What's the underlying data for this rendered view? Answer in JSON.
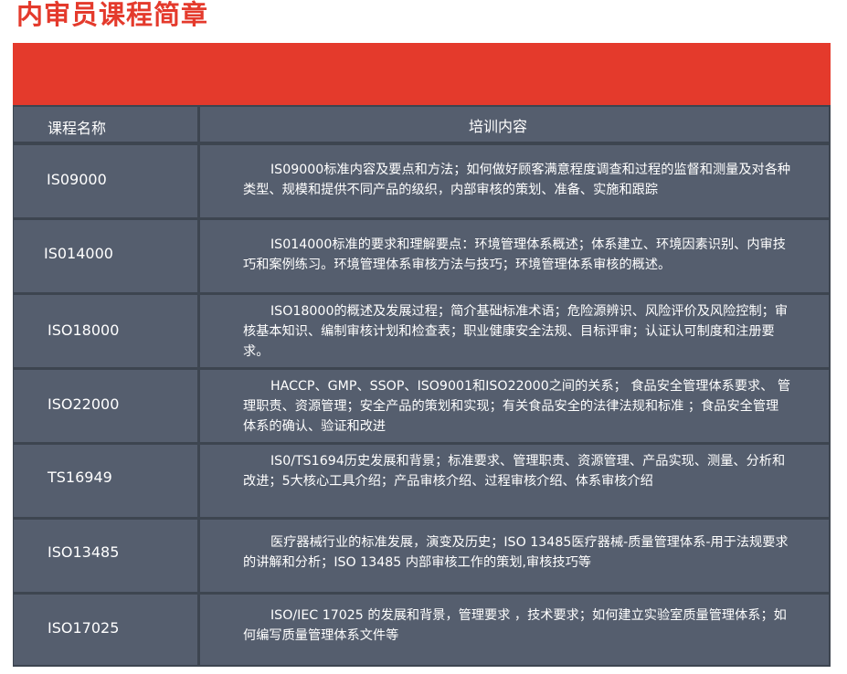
{
  "title": "内审员课程简章",
  "table": {
    "header": {
      "name_label": "课程名称",
      "content_label": "培训内容"
    },
    "rows": [
      {
        "name": "IS09000",
        "content": "IS09000标准内容及要点和方法；如何做好顾客满意程度调查和过程的监督和测量及对各种类型、规模和提供不同产品的级织，内部审核的策划、准备、实施和跟踪"
      },
      {
        "name": "IS014000",
        "content": "IS014000标准的要求和理解要点：环境管理体系概述；体系建立、环境因素识别、内审技巧和案例练习。环境管理体系审核方法与技巧；环境管理体系审核的概述。"
      },
      {
        "name": "ISO18000",
        "content": "ISO18000的概述及发展过程；简介基础标准术语；危险源辨识、风险评价及风险控制；审核基本知识、编制审核计划和检查表；职业健康安全法规、目标评审；认证认可制度和注册要求。"
      },
      {
        "name": "ISO22000",
        "content": "HACCP、GMP、SSOP、ISO9001和ISO22000之间的关系； 食品安全管理体系要求、 管理职责、资源管理；安全产品的策划和实现；有关食品安全的法律法规和标准 ；食品安全管理体系的确认、验证和改进"
      },
      {
        "name": "TS16949",
        "content": "IS0/TS1694历史发展和背景；标准要求、管理职责、资源管理、产品实现、测量、分析和改进；5大核心工具介绍；产品审核介绍、过程审核介绍、体系审核介绍"
      },
      {
        "name": "ISO13485",
        "content": "医疗器械行业的标准发展，演变及历史；ISO 13485医疗器械-质量管理体系-用于法规要求的讲解和分析；ISO 13485 内部审核工作的策划,审核技巧等"
      },
      {
        "name": "ISO17025",
        "content": "ISO/IEC 17025 的发展和背景，管理要求 ，技术要求；如何建立实验室质量管理体系；如何编写质量管理体系文件等"
      }
    ]
  }
}
